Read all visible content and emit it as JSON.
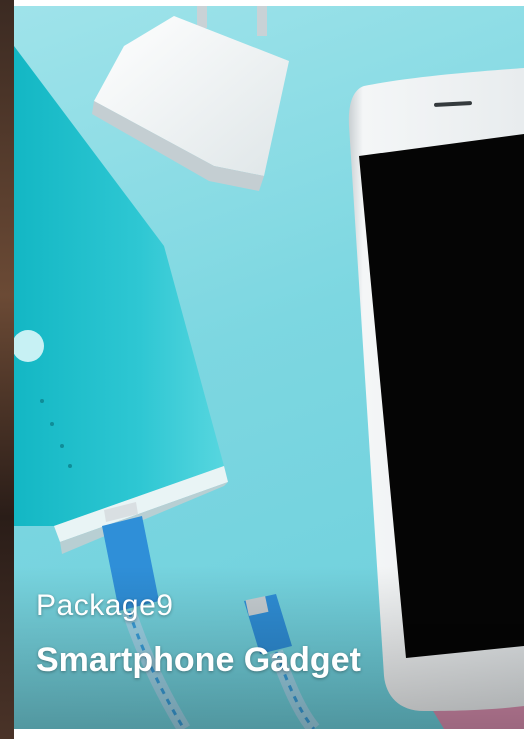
{
  "card": {
    "package_label": "Package9",
    "product_title": "Smartphone Gadget"
  },
  "image": {
    "subject": [
      "smartphone",
      "power-bank",
      "wall-charger",
      "usb-cable"
    ]
  },
  "colors": {
    "background": "#7fd8e2",
    "power_bank": "#2cc6d2",
    "phone_screen": "#050505",
    "phone_body": "#f1f3f4",
    "charger": "#f7f9f9",
    "cable_connector": "#2f8fd8",
    "pink_corner": "#d98fb0",
    "caption_text": "#ffffff"
  }
}
